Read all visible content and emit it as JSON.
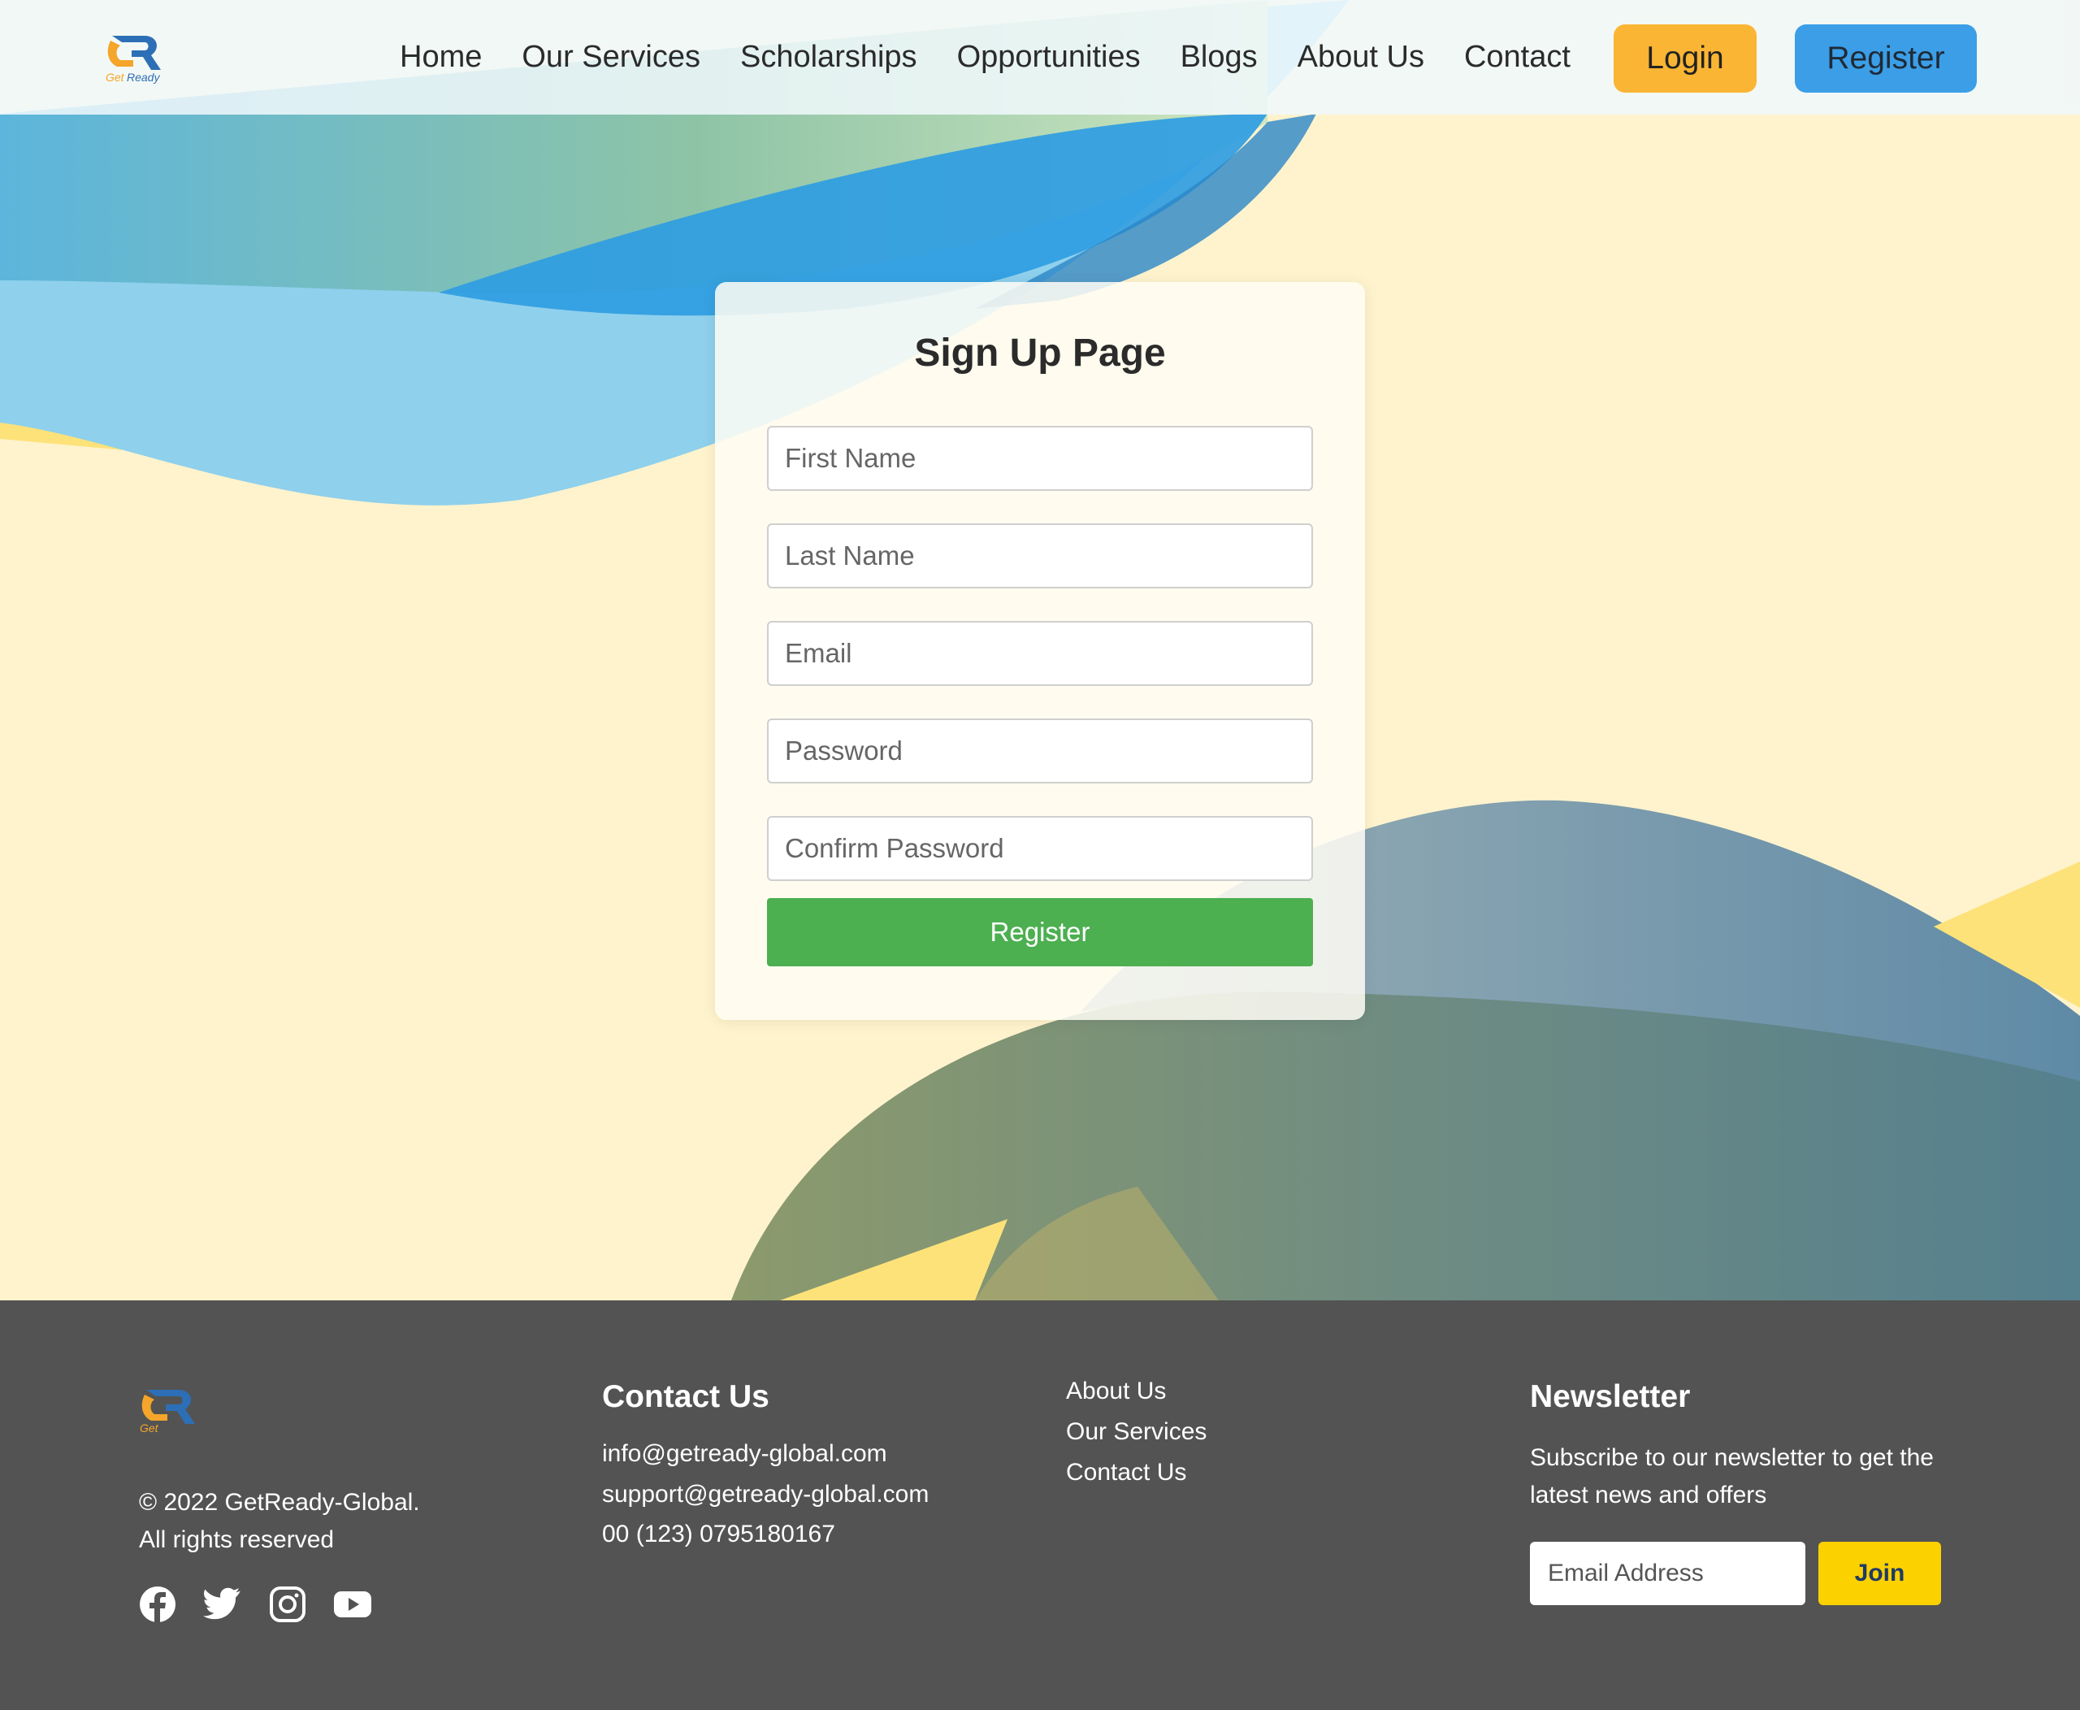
{
  "brand": {
    "logo_icon": "getready-logo-icon",
    "logo_text": "GetReady"
  },
  "nav": {
    "items": [
      {
        "label": "Home"
      },
      {
        "label": "Our Services"
      },
      {
        "label": "Scholarships"
      },
      {
        "label": "Opportunities"
      },
      {
        "label": "Blogs"
      },
      {
        "label": "About Us"
      },
      {
        "label": "Contact"
      }
    ],
    "login_label": "Login",
    "register_label": "Register"
  },
  "form": {
    "title": "Sign Up Page",
    "first_name_placeholder": "First Name",
    "last_name_placeholder": "Last Name",
    "email_placeholder": "Email",
    "password_placeholder": "Password",
    "confirm_password_placeholder": "Confirm Password",
    "submit_label": "Register"
  },
  "footer": {
    "copyright_line1": "© 2022 GetReady-Global.",
    "copyright_line2": "All rights reserved",
    "social_icons": [
      "facebook-icon",
      "twitter-icon",
      "instagram-icon",
      "youtube-icon"
    ],
    "contact": {
      "title": "Contact Us",
      "email1": "info@getready-global.com",
      "email2": "support@getready-global.com",
      "phone": "00 (123) 0795180167"
    },
    "links": [
      {
        "label": "About Us"
      },
      {
        "label": "Our Services"
      },
      {
        "label": "Contact Us"
      }
    ],
    "newsletter": {
      "title": "Newsletter",
      "text_line1": "Subscribe to our newsletter to get the",
      "text_line2": "latest news and offers",
      "input_placeholder": "Email Address",
      "join_label": "Join"
    }
  },
  "colors": {
    "login_bg": "#fbb534",
    "register_bg": "#3b9ee7",
    "submit_bg": "#4caf50",
    "footer_bg": "#535353",
    "join_bg": "#fcd100"
  }
}
